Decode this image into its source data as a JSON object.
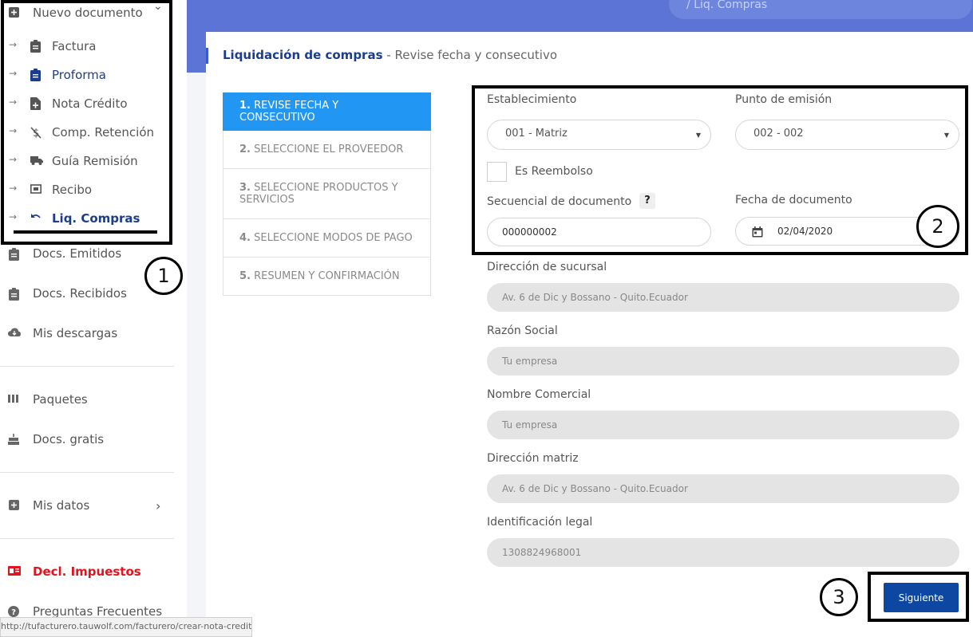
{
  "breadcrumb": {
    "text": "/  Liq. Compras"
  },
  "sidebar": {
    "new_doc": {
      "label": "Nuevo documento",
      "icon": "plus-square-icon"
    },
    "sub_items": [
      {
        "label": "Factura",
        "icon": "clipboard-icon"
      },
      {
        "label": "Proforma",
        "icon": "clipboard-icon"
      },
      {
        "label": "Nota Crédito",
        "icon": "file-plus-icon"
      },
      {
        "label": "Comp. Retención",
        "icon": "money-off-icon"
      },
      {
        "label": "Guía Remisión",
        "icon": "truck-icon"
      },
      {
        "label": "Recibo",
        "icon": "receipt-icon"
      },
      {
        "label": "Liq. Compras",
        "icon": "undo-icon"
      }
    ],
    "items": [
      {
        "label": "Docs. Emitidos",
        "icon": "clipboard-icon"
      },
      {
        "label": "Docs. Recibidos",
        "icon": "clipboard-icon"
      },
      {
        "label": "Mis descargas",
        "icon": "cloud-download-icon"
      },
      {
        "label": "Paquetes",
        "icon": "bars-icon"
      },
      {
        "label": "Docs. gratis",
        "icon": "cake-icon"
      },
      {
        "label": "Mis datos",
        "icon": "plus-square-icon"
      },
      {
        "label": "Decl. Impuestos",
        "icon": "tax-icon"
      },
      {
        "label": "Preguntas Frecuentes",
        "icon": "help-circle-icon"
      }
    ],
    "arrow": "→",
    "chevron_down": "⌄",
    "chevron_right": "›"
  },
  "card": {
    "title": "Liquidación de compras",
    "separator": " - ",
    "subtitle": "Revise fecha y consecutivo"
  },
  "steps": [
    {
      "num": "1.",
      "label": "REVISE FECHA Y CONSECUTIVO",
      "active": true
    },
    {
      "num": "2.",
      "label": "SELECCIONE EL PROVEEDOR"
    },
    {
      "num": "3.",
      "label": "SELECCIONE PRODUCTOS Y SERVICIOS"
    },
    {
      "num": "4.",
      "label": "SELECCIONE MODOS DE PAGO"
    },
    {
      "num": "5.",
      "label": "RESUMEN Y CONFIRMACIÓN"
    }
  ],
  "form": {
    "establecimiento_label": "Establecimiento",
    "establecimiento_value": "001 - Matriz",
    "punto_label": "Punto de emisión",
    "punto_value": "002 - 002",
    "reembolso_label": "Es Reembolso",
    "secuencial_label": "Secuencial de documento",
    "secuencial_value": "000000002",
    "help_glyph": "?",
    "fecha_label": "Fecha de documento",
    "fecha_value": "02/04/2020",
    "dir_sucursal_label": "Dirección de sucursal",
    "dir_sucursal_value": "Av. 6 de Dic y Bossano - Quito.Ecuador",
    "razon_label": "Razón Social",
    "razon_value": "Tu empresa",
    "nombre_label": "Nombre Comercial",
    "nombre_value": "Tu empresa",
    "dir_matriz_label": "Dirección matriz",
    "dir_matriz_value": "Av. 6 de Dic y Bossano - Quito.Ecuador",
    "ident_label": "Identificación legal",
    "ident_value": "1308824968001"
  },
  "next_button": "Siguiente",
  "annotations": [
    "1",
    "2",
    "3"
  ],
  "status_url": "http://tufacturero.tauwolf.com/facturero/crear-nota-credito"
}
